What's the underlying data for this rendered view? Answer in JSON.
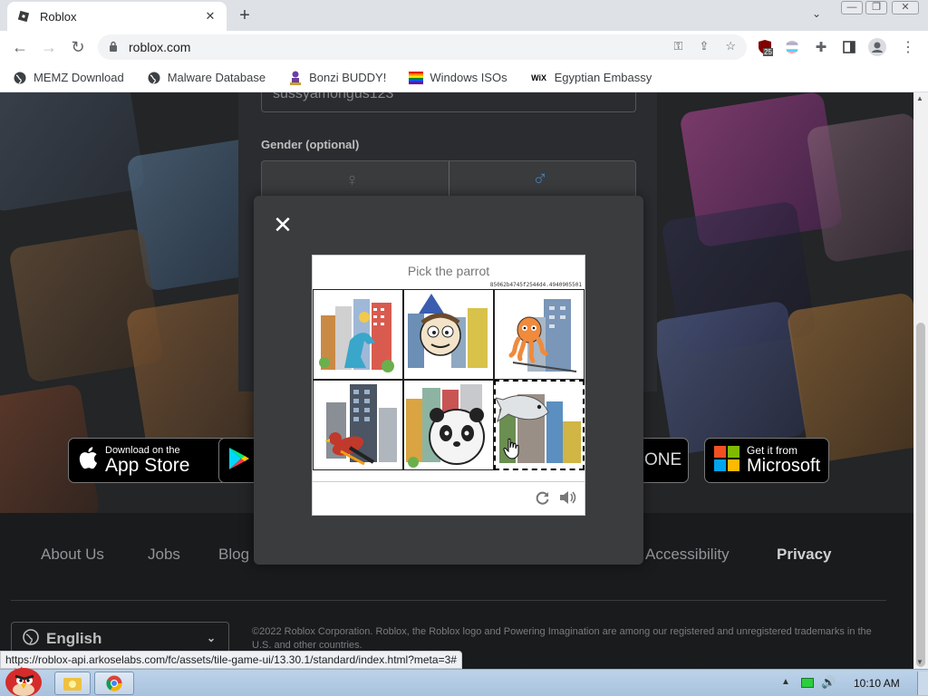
{
  "browser": {
    "tab_title": "Roblox",
    "url": "roblox.com",
    "extension_badge": "25",
    "bookmarks": [
      {
        "label": "MEMZ Download",
        "icon": "globe-icon"
      },
      {
        "label": "Malware Database",
        "icon": "globe-icon"
      },
      {
        "label": "Bonzi BUDDY!",
        "icon": "bonzi-icon"
      },
      {
        "label": "Windows ISOs",
        "icon": "rainbow-flag-icon"
      },
      {
        "label": "Egyptian Embassy",
        "icon": "wix-icon"
      }
    ],
    "wix_text": "WiX",
    "status_url": "https://roblox-api.arkoselabs.com/fc/assets/tile-game-ui/13.30.1/standard/index.html?meta=3#"
  },
  "page": {
    "username_value": "sussyamongus123",
    "gender_label": "Gender (optional)",
    "store": {
      "appstore_small": "Download on the",
      "appstore_big": "App Store",
      "xbox_text": "ONE",
      "ms_small": "Get it from",
      "ms_big": "Microsoft"
    },
    "footer_links": [
      "About Us",
      "Jobs",
      "Blog",
      "Accessibility",
      "Privacy"
    ],
    "language": "English",
    "copyright": "©2022 Roblox Corporation. Roblox, the Roblox logo and Powering Imagination are among our registered and unregistered trademarks in the U.S. and other countries."
  },
  "captcha": {
    "prompt": "Pick the parrot",
    "challenge_id": "85062b4745f2544d4.4940905501",
    "tiles": [
      {
        "content": "dinosaur"
      },
      {
        "content": "cartoon-face"
      },
      {
        "content": "octopus"
      },
      {
        "content": "parrot"
      },
      {
        "content": "panda"
      },
      {
        "content": "fish"
      }
    ],
    "selected_tile": 6
  },
  "taskbar": {
    "time": "10:10 AM"
  },
  "colors": {
    "accent": "#1a73e8",
    "page_bg": "#232527",
    "overlay_bg": "#3b3c3d"
  }
}
